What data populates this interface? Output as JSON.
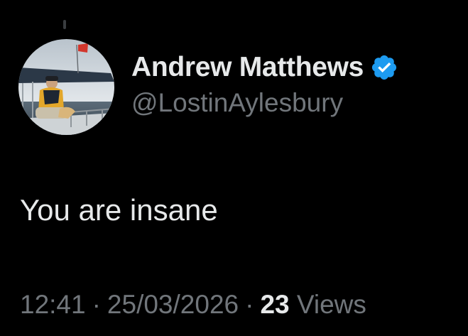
{
  "tweet": {
    "author": {
      "display_name": "Andrew Matthews",
      "handle": "@LostinAylesbury",
      "verified": true,
      "verified_badge_icon": "verified-badge-icon",
      "avatar": "profile-photo-sailing"
    },
    "text": "You are insane",
    "time": "12:41",
    "date": "25/03/2026",
    "separator": "·",
    "views_count": "23",
    "views_label": "Views"
  },
  "colors": {
    "background": "#000000",
    "primary_text": "#e7e9ea",
    "secondary_text": "#71767b",
    "verified_badge": "#1d9bf0"
  }
}
